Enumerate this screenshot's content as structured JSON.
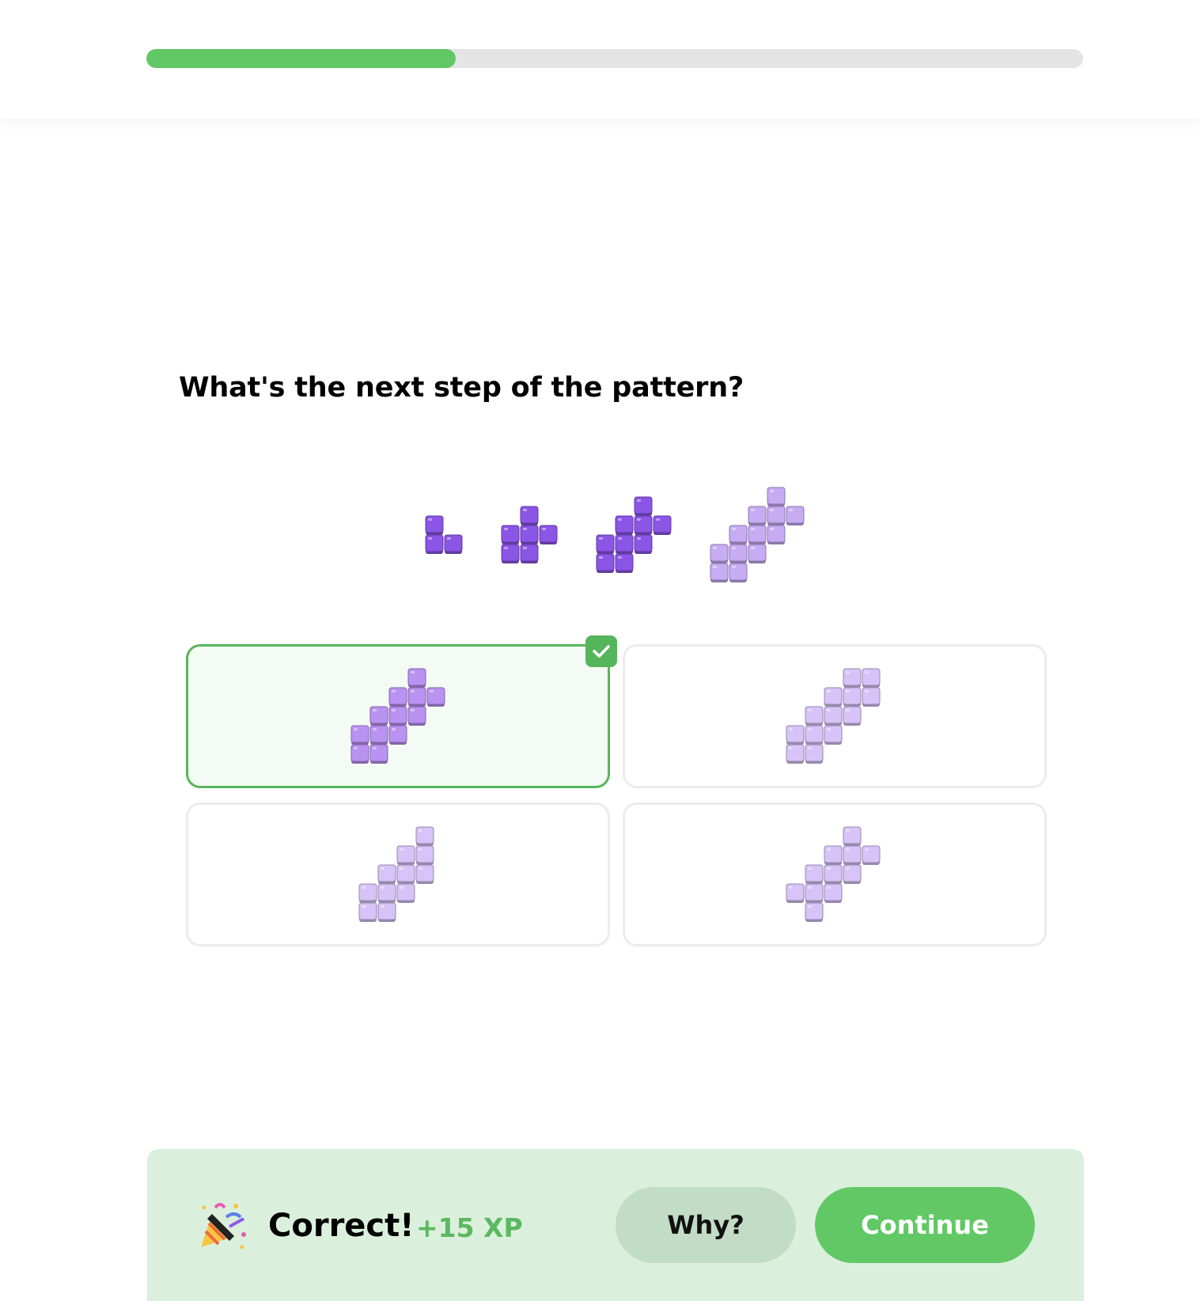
{
  "progress": {
    "value": 0.33
  },
  "question": {
    "text": "What's the next step of the pattern?"
  },
  "colors": {
    "accent": "#62c866",
    "block_dark": "#8b55e6",
    "block_light": "#d7c3f7",
    "correct_border": "#58b65c"
  },
  "sequence": {
    "steps": [
      [
        [
          0,
          0
        ],
        [
          0,
          1
        ],
        [
          1,
          1
        ]
      ],
      [
        [
          1,
          0
        ],
        [
          0,
          1
        ],
        [
          1,
          1
        ],
        [
          2,
          1
        ],
        [
          0,
          2
        ],
        [
          1,
          2
        ]
      ],
      [
        [
          2,
          0
        ],
        [
          1,
          1
        ],
        [
          2,
          1
        ],
        [
          3,
          1
        ],
        [
          0,
          2
        ],
        [
          1,
          2
        ],
        [
          2,
          2
        ],
        [
          0,
          3
        ],
        [
          1,
          3
        ]
      ],
      [
        [
          3,
          0
        ],
        [
          2,
          1
        ],
        [
          3,
          1
        ],
        [
          4,
          1
        ],
        [
          1,
          2
        ],
        [
          2,
          2
        ],
        [
          3,
          2
        ],
        [
          0,
          3
        ],
        [
          1,
          3
        ],
        [
          2,
          3
        ],
        [
          0,
          4
        ],
        [
          1,
          4
        ]
      ]
    ]
  },
  "options": [
    {
      "id": "A",
      "selected": true,
      "correct": true,
      "blocks": [
        [
          3,
          0
        ],
        [
          2,
          1
        ],
        [
          3,
          1
        ],
        [
          4,
          1
        ],
        [
          1,
          2
        ],
        [
          2,
          2
        ],
        [
          3,
          2
        ],
        [
          0,
          3
        ],
        [
          1,
          3
        ],
        [
          2,
          3
        ],
        [
          0,
          4
        ],
        [
          1,
          4
        ]
      ]
    },
    {
      "id": "B",
      "selected": false,
      "correct": false,
      "blocks": [
        [
          3,
          0
        ],
        [
          4,
          0
        ],
        [
          2,
          1
        ],
        [
          3,
          1
        ],
        [
          4,
          1
        ],
        [
          1,
          2
        ],
        [
          2,
          2
        ],
        [
          3,
          2
        ],
        [
          0,
          3
        ],
        [
          1,
          3
        ],
        [
          2,
          3
        ],
        [
          0,
          4
        ],
        [
          1,
          4
        ]
      ]
    },
    {
      "id": "C",
      "selected": false,
      "correct": false,
      "blocks": [
        [
          3,
          0
        ],
        [
          2,
          1
        ],
        [
          3,
          1
        ],
        [
          1,
          2
        ],
        [
          2,
          2
        ],
        [
          3,
          2
        ],
        [
          0,
          3
        ],
        [
          1,
          3
        ],
        [
          2,
          3
        ],
        [
          0,
          4
        ],
        [
          1,
          4
        ]
      ]
    },
    {
      "id": "D",
      "selected": false,
      "correct": false,
      "blocks": [
        [
          3,
          0
        ],
        [
          2,
          1
        ],
        [
          3,
          1
        ],
        [
          4,
          1
        ],
        [
          1,
          2
        ],
        [
          2,
          2
        ],
        [
          3,
          2
        ],
        [
          0,
          3
        ],
        [
          1,
          3
        ],
        [
          2,
          3
        ],
        [
          1,
          4
        ]
      ]
    }
  ],
  "feedback": {
    "title": "Correct!",
    "xp": "+15 XP",
    "icon": "party-popper-icon",
    "why_label": "Why?",
    "continue_label": "Continue"
  }
}
